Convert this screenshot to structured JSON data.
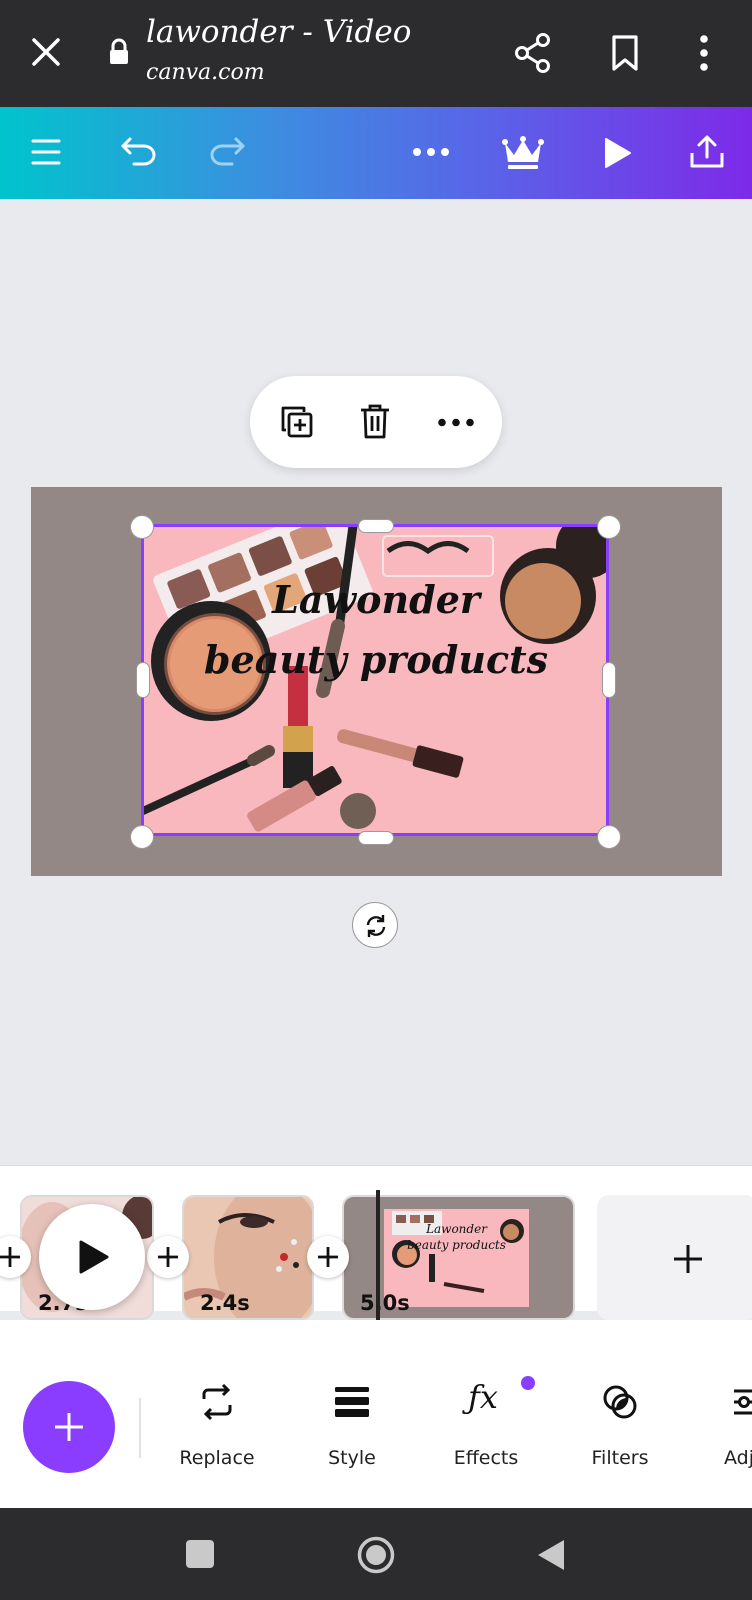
{
  "browser": {
    "title": "lawonder - Video",
    "url": "canva.com",
    "icons": [
      "close-icon",
      "lock-icon",
      "share-icon",
      "bookmark-icon",
      "more-vert-icon"
    ]
  },
  "toolbar": {
    "icons": [
      "menu-icon",
      "undo-icon",
      "redo-icon",
      "more-horiz-icon",
      "crown-icon",
      "play-icon",
      "upload-icon"
    ]
  },
  "design": {
    "line1": "Lawonder",
    "line2": "beauty products"
  },
  "context_menu": {
    "icons": [
      "duplicate-icon",
      "trash-icon",
      "more-horiz-icon"
    ]
  },
  "timeline": {
    "clips": [
      {
        "duration": "2.7s"
      },
      {
        "duration": "2.4s"
      },
      {
        "duration": "5.0s",
        "thumb_line1": "Lawonder",
        "thumb_line2": "beauty products"
      }
    ]
  },
  "bottom_tools": [
    {
      "label": "Replace",
      "icon": "replace-icon"
    },
    {
      "label": "Style",
      "icon": "style-icon"
    },
    {
      "label": "Effects",
      "icon": "effects-icon"
    },
    {
      "label": "Filters",
      "icon": "filters-icon"
    },
    {
      "label": "Adj",
      "icon": "adjust-icon"
    }
  ],
  "colors": {
    "accent": "#8b3dff",
    "gradient_start": "#00c4cc",
    "gradient_end": "#7d2ae8",
    "photo_pink": "#f8b8bd",
    "page_bg": "#948887"
  }
}
